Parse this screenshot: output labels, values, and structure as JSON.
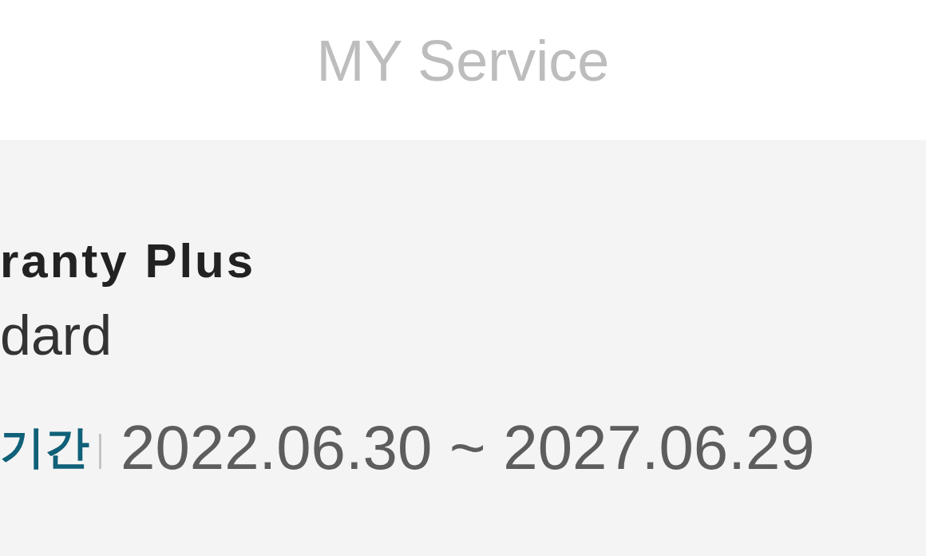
{
  "header": {
    "title": "MY Service"
  },
  "service": {
    "product": "ranty Plus",
    "grade": "dard",
    "period": {
      "label": "기간",
      "value": "2022.06.30 ~ 2027.06.29"
    }
  }
}
